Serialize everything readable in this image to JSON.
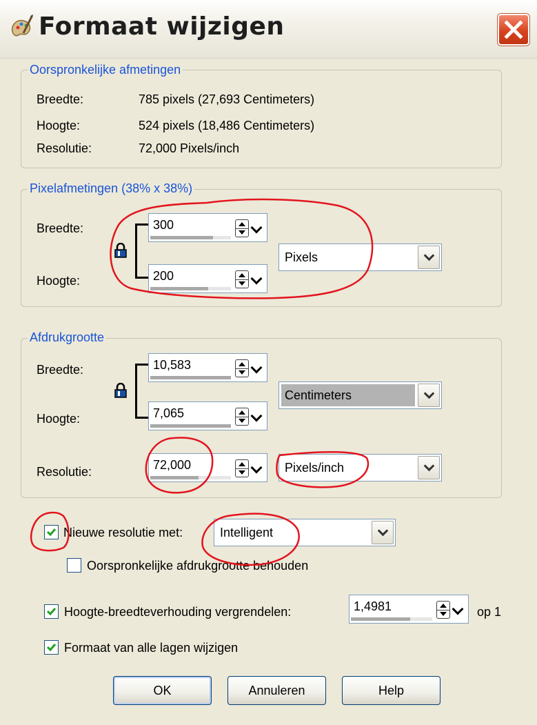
{
  "window": {
    "title": "Formaat wijzigen"
  },
  "original": {
    "legend": "Oorspronkelijke afmetingen",
    "width_label": "Breedte:",
    "width_value": "785 pixels (27,693 Centimeters)",
    "height_label": "Hoogte:",
    "height_value": "524 pixels (18,486 Centimeters)",
    "resolution_label": "Resolutie:",
    "resolution_value": "72,000 Pixels/inch"
  },
  "pixel_dims": {
    "legend": "Pixelafmetingen (38% x 38%)",
    "width_label": "Breedte:",
    "width_value": "300",
    "height_label": "Hoogte:",
    "height_value": "200",
    "unit": "Pixels"
  },
  "print_size": {
    "legend": "Afdrukgrootte",
    "width_label": "Breedte:",
    "width_value": "10,583",
    "height_label": "Hoogte:",
    "height_value": "7,065",
    "unit": "Centimeters",
    "resolution_label": "Resolutie:",
    "resolution_value": "72,000",
    "resolution_unit": "Pixels/inch"
  },
  "resample": {
    "label": "Nieuwe resolutie met:",
    "checked": true,
    "method": "Intelligent"
  },
  "keep_print_size": {
    "label": "Oorspronkelijke afdrukgrootte behouden",
    "checked": false
  },
  "aspect": {
    "label": "Hoogte-breedteverhouding vergrendelen:",
    "checked": true,
    "value": "1,4981",
    "suffix": "op 1"
  },
  "all_layers": {
    "label": "Formaat van alle lagen wijzigen",
    "checked": true
  },
  "buttons": {
    "ok": "OK",
    "cancel": "Annuleren",
    "help": "Help"
  },
  "colors": {
    "legend": "#1a53d8",
    "annotation": "#e3141e",
    "dialog_bg": "#ece9d8",
    "close": "#d8431f"
  }
}
